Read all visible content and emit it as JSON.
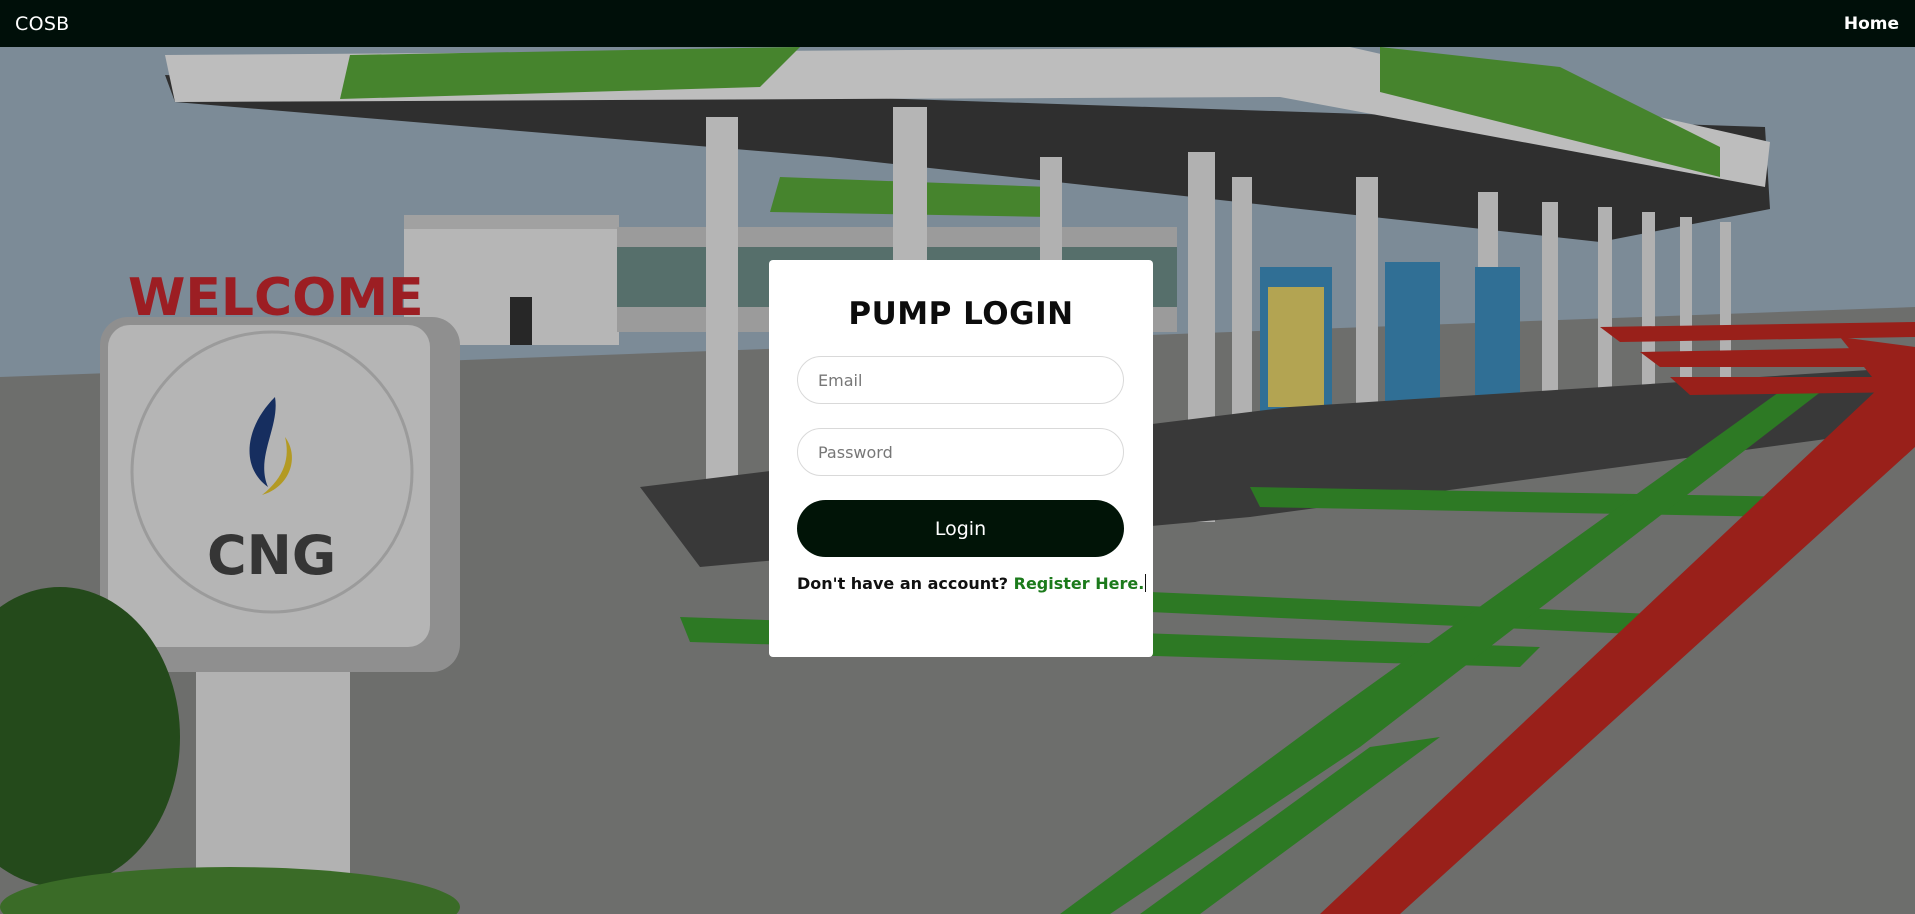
{
  "navbar": {
    "brand": "COSB",
    "home_label": "Home"
  },
  "hero": {
    "sign_text": "WELCOME",
    "sign_label": "CNG"
  },
  "login_card": {
    "title": "PUMP LOGIN",
    "email_placeholder": "Email",
    "email_value": "",
    "password_placeholder": "Password",
    "password_value": "",
    "login_label": "Login",
    "register_prompt": "Don't have an account? ",
    "register_link": "Register Here."
  },
  "colors": {
    "navbar_bg": "#000f09",
    "button_bg": "#011407",
    "link_green": "#1b7a1b",
    "card_bg": "#ffffff"
  }
}
